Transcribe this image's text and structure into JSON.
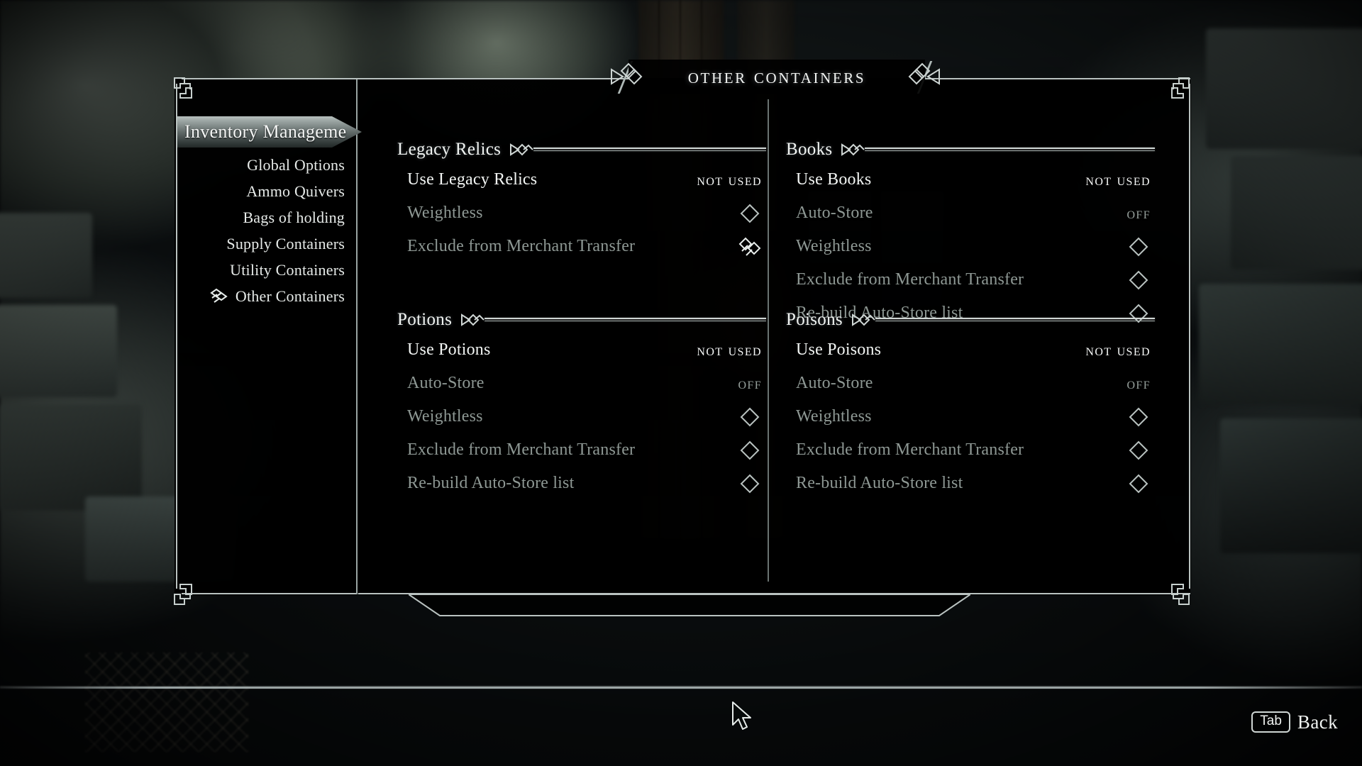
{
  "header": {
    "title": "Other Containers"
  },
  "sidebar": {
    "active_tab": "Inventory Manageme",
    "items": [
      {
        "label": "Global Options",
        "selected": false
      },
      {
        "label": "Ammo Quivers",
        "selected": false
      },
      {
        "label": "Bags of holding",
        "selected": false
      },
      {
        "label": "Supply Containers",
        "selected": false
      },
      {
        "label": "Utility Containers",
        "selected": false
      },
      {
        "label": "Other Containers",
        "selected": true
      }
    ]
  },
  "sections": [
    {
      "title": "Legacy Relics",
      "column": "left",
      "rows": [
        {
          "name": "Use Legacy Relics",
          "value": "NOT USED",
          "type": "text",
          "enabled": true,
          "highlighted": false
        },
        {
          "name": "Weightless",
          "value": "",
          "type": "checkbox",
          "checked": false,
          "enabled": false,
          "highlighted": false
        },
        {
          "name": "Exclude from Merchant Transfer",
          "value": "",
          "type": "checkbox",
          "checked": false,
          "enabled": false,
          "highlighted": true
        }
      ]
    },
    {
      "title": "Potions",
      "column": "left",
      "rows": [
        {
          "name": "Use Potions",
          "value": "NOT USED",
          "type": "text",
          "enabled": true,
          "highlighted": false
        },
        {
          "name": "Auto-Store",
          "value": "OFF",
          "type": "text",
          "enabled": false,
          "highlighted": false
        },
        {
          "name": "Weightless",
          "value": "",
          "type": "checkbox",
          "checked": false,
          "enabled": false,
          "highlighted": false
        },
        {
          "name": "Exclude from Merchant Transfer",
          "value": "",
          "type": "checkbox",
          "checked": false,
          "enabled": false,
          "highlighted": false
        },
        {
          "name": "Re-build Auto-Store list",
          "value": "",
          "type": "checkbox",
          "checked": false,
          "enabled": false,
          "highlighted": false
        }
      ]
    },
    {
      "title": "Books",
      "column": "right",
      "rows": [
        {
          "name": "Use Books",
          "value": "NOT USED",
          "type": "text",
          "enabled": true,
          "highlighted": false
        },
        {
          "name": "Auto-Store",
          "value": "OFF",
          "type": "text",
          "enabled": false,
          "highlighted": false
        },
        {
          "name": "Weightless",
          "value": "",
          "type": "checkbox",
          "checked": false,
          "enabled": false,
          "highlighted": false
        },
        {
          "name": "Exclude from Merchant Transfer",
          "value": "",
          "type": "checkbox",
          "checked": false,
          "enabled": false,
          "highlighted": false
        },
        {
          "name": "Re-build Auto-Store list",
          "value": "",
          "type": "checkbox",
          "checked": false,
          "enabled": false,
          "highlighted": false
        }
      ]
    },
    {
      "title": "Poisons",
      "column": "right",
      "rows": [
        {
          "name": "Use Poisons",
          "value": "NOT USED",
          "type": "text",
          "enabled": true,
          "highlighted": false
        },
        {
          "name": "Auto-Store",
          "value": "OFF",
          "type": "text",
          "enabled": false,
          "highlighted": false
        },
        {
          "name": "Weightless",
          "value": "",
          "type": "checkbox",
          "checked": false,
          "enabled": false,
          "highlighted": false
        },
        {
          "name": "Exclude from Merchant Transfer",
          "value": "",
          "type": "checkbox",
          "checked": false,
          "enabled": false,
          "highlighted": false
        },
        {
          "name": "Re-build Auto-Store list",
          "value": "",
          "type": "checkbox",
          "checked": false,
          "enabled": false,
          "highlighted": false
        }
      ]
    }
  ],
  "footer": {
    "back_key": "Tab",
    "back_label": "Back"
  },
  "colors": {
    "frame_line": "#b9c2c0",
    "text_enabled": "#f2f5f3",
    "text_disabled": "#8e9894",
    "panel_bg": "#000000"
  }
}
